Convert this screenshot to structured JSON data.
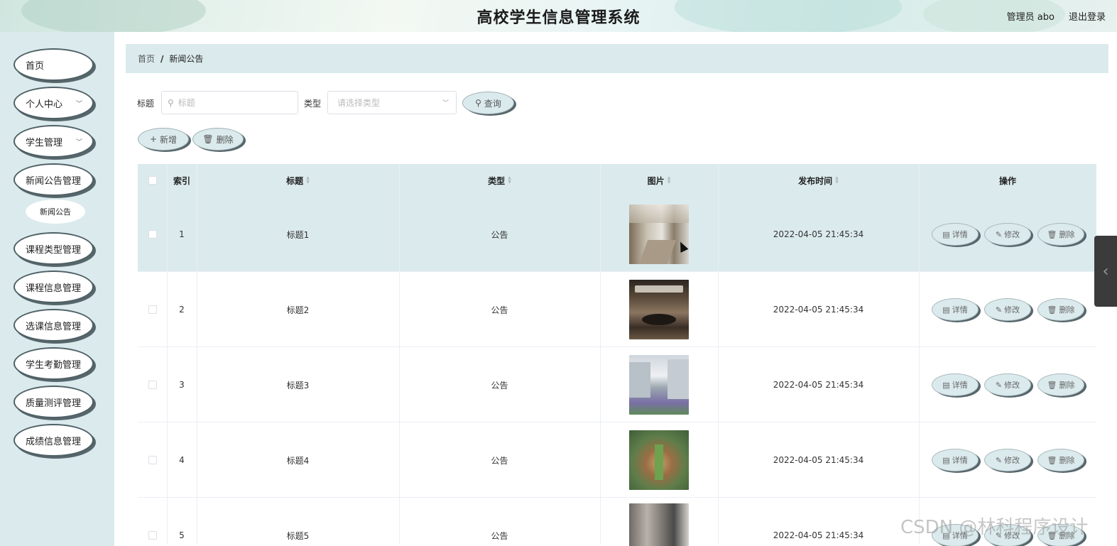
{
  "header": {
    "title": "高校学生信息管理系统",
    "user_label": "管理员 abo",
    "logout_label": "退出登录"
  },
  "sidebar": {
    "items": [
      {
        "label": "首页",
        "has_submenu": false
      },
      {
        "label": "个人中心",
        "has_submenu": true
      },
      {
        "label": "学生管理",
        "has_submenu": true
      },
      {
        "label": "新闻公告管理",
        "has_submenu": false
      },
      {
        "label": "课程类型管理",
        "has_submenu": false
      },
      {
        "label": "课程信息管理",
        "has_submenu": false
      },
      {
        "label": "选课信息管理",
        "has_submenu": false
      },
      {
        "label": "学生考勤管理",
        "has_submenu": false
      },
      {
        "label": "质量测评管理",
        "has_submenu": false
      },
      {
        "label": "成绩信息管理",
        "has_submenu": false
      }
    ],
    "submenu_item": "新闻公告"
  },
  "breadcrumb": {
    "home": "首页",
    "separator": "/",
    "current": "新闻公告"
  },
  "search": {
    "title_label": "标题",
    "title_placeholder": "标题",
    "type_label": "类型",
    "type_placeholder": "请选择类型",
    "query_button": "查询"
  },
  "actions": {
    "add_button": "新增",
    "delete_button": "删除"
  },
  "table": {
    "columns": {
      "index": "索引",
      "title": "标题",
      "type": "类型",
      "image": "图片",
      "time": "发布时间",
      "ops": "操作"
    },
    "op_labels": {
      "detail": "详情",
      "edit": "修改",
      "delete": "删除"
    },
    "rows": [
      {
        "index": "1",
        "title": "标题1",
        "type": "公告",
        "time": "2022-04-05 21:45:34"
      },
      {
        "index": "2",
        "title": "标题2",
        "type": "公告",
        "time": "2022-04-05 21:45:34"
      },
      {
        "index": "3",
        "title": "标题3",
        "type": "公告",
        "time": "2022-04-05 21:45:34"
      },
      {
        "index": "4",
        "title": "标题4",
        "type": "公告",
        "time": "2022-04-05 21:45:34"
      },
      {
        "index": "5",
        "title": "标题5",
        "type": "公告",
        "time": "2022-04-05 21:45:34"
      }
    ]
  },
  "watermark": "CSDN @林科程序设计",
  "colors": {
    "panel_bg": "#dbeaed",
    "pill_shadow": "#56666b"
  },
  "icons": [
    "search-icon",
    "chevron-down-icon",
    "plus-icon",
    "trash-icon",
    "document-icon",
    "pencil-icon",
    "chevron-left-icon",
    "sort-icon"
  ]
}
